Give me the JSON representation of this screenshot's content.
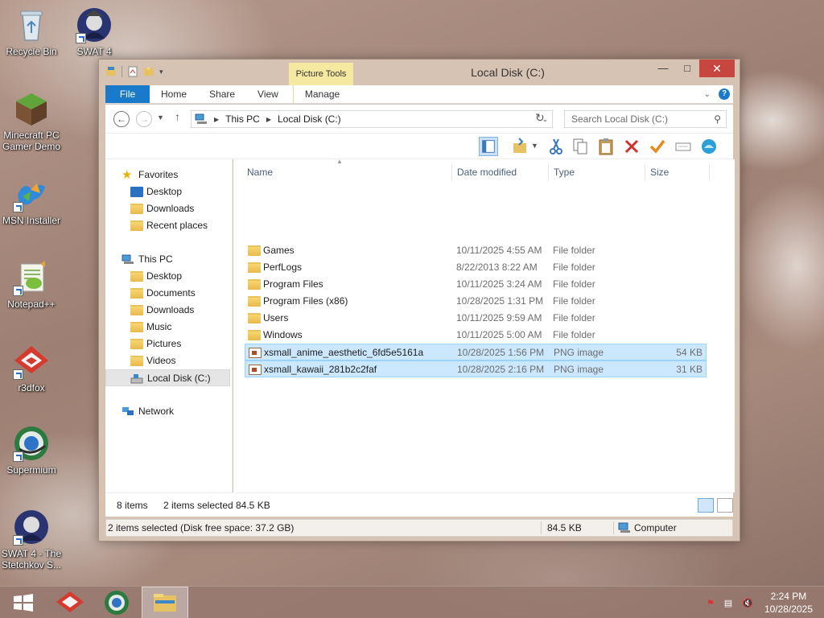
{
  "desktop": {
    "icons": [
      {
        "label": "Recycle Bin",
        "icon": "recycle-bin-icon"
      },
      {
        "label": "SWAT 4",
        "icon": "swat4-icon"
      },
      {
        "label": "Minecraft PC Gamer Demo",
        "icon": "minecraft-icon"
      },
      {
        "label": "MSN Installer",
        "icon": "msn-icon"
      },
      {
        "label": "Notepad++",
        "icon": "notepadpp-icon"
      },
      {
        "label": "r3dfox",
        "icon": "r3dfox-icon"
      },
      {
        "label": "Supermium",
        "icon": "supermium-icon"
      },
      {
        "label": "SWAT 4 - The Stetchkov S...",
        "icon": "swat4-expansion-icon"
      }
    ]
  },
  "window": {
    "title": "Local Disk (C:)",
    "contextual_tab_group": "Picture Tools",
    "ribbon_tabs": [
      "File",
      "Home",
      "Share",
      "View",
      "Manage"
    ],
    "breadcrumb": [
      "This PC",
      "Local Disk (C:)"
    ],
    "search_placeholder": "Search Local Disk (C:)",
    "accent_color": "#1979ca",
    "close_color": "#c7463f"
  },
  "navpane": {
    "favorites": {
      "label": "Favorites",
      "items": [
        "Desktop",
        "Downloads",
        "Recent places"
      ]
    },
    "this_pc": {
      "label": "This PC",
      "items": [
        "Desktop",
        "Documents",
        "Downloads",
        "Music",
        "Pictures",
        "Videos",
        "Local Disk (C:)"
      ]
    },
    "network": {
      "label": "Network"
    },
    "selected": "Local Disk (C:)"
  },
  "columns": [
    "Name",
    "Date modified",
    "Type",
    "Size"
  ],
  "files": [
    {
      "name": "Games",
      "date": "10/11/2025 4:55 AM",
      "type": "File folder",
      "size": "",
      "kind": "folder",
      "selected": false
    },
    {
      "name": "PerfLogs",
      "date": "8/22/2013 8:22 AM",
      "type": "File folder",
      "size": "",
      "kind": "folder",
      "selected": false
    },
    {
      "name": "Program Files",
      "date": "10/11/2025 3:24 AM",
      "type": "File folder",
      "size": "",
      "kind": "folder",
      "selected": false
    },
    {
      "name": "Program Files (x86)",
      "date": "10/28/2025 1:31 PM",
      "type": "File folder",
      "size": "",
      "kind": "folder",
      "selected": false
    },
    {
      "name": "Users",
      "date": "10/11/2025 9:59 AM",
      "type": "File folder",
      "size": "",
      "kind": "folder",
      "selected": false
    },
    {
      "name": "Windows",
      "date": "10/11/2025 5:00 AM",
      "type": "File folder",
      "size": "",
      "kind": "folder",
      "selected": false
    },
    {
      "name": "xsmall_anime_aesthetic_6fd5e5161a",
      "date": "10/28/2025 1:56 PM",
      "type": "PNG image",
      "size": "54 KB",
      "kind": "png",
      "selected": true
    },
    {
      "name": "xsmall_kawaii_281b2c2faf",
      "date": "10/28/2025 2:16 PM",
      "type": "PNG image",
      "size": "31 KB",
      "kind": "png",
      "selected": true
    }
  ],
  "items_bar": {
    "count": "8 items",
    "selected": "2 items selected",
    "size": "84.5 KB"
  },
  "statusbar": {
    "left": "2 items selected (Disk free space: 37.2 GB)",
    "size": "84.5 KB",
    "location": "Computer"
  },
  "taskbar": {
    "time": "2:24 PM",
    "date": "10/28/2025"
  }
}
